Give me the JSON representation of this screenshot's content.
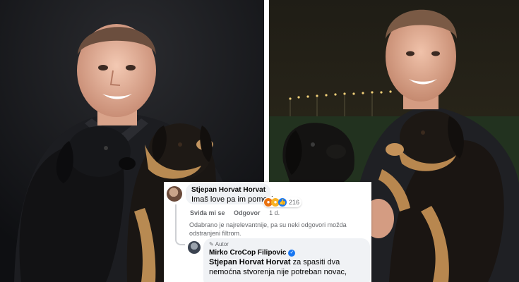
{
  "comment": {
    "author": "Stjepan Horvat Horvat",
    "text": "Imaš love pa im pomozi",
    "reactions": {
      "icons": [
        "angry-icon",
        "haha-icon",
        "like-icon"
      ],
      "count": "216"
    },
    "actions": {
      "like": "Sviđa mi se",
      "reply": "Odgovor",
      "time": "1 d."
    }
  },
  "notice": "Odabrano je najrelevantnije, pa su neki odgovori možda odstranjeni filtrom.",
  "reply": {
    "badge": "Autor",
    "author": "Mirko CroCop Filipovic",
    "mention": "Stjepan Horvat Horvat",
    "text": " za spasiti dva nemoćna stvorenja nije potreban novac,"
  },
  "colors": {
    "link_blue": "#1877f2",
    "bubble": "#f0f2f5",
    "muted": "#65676b"
  }
}
